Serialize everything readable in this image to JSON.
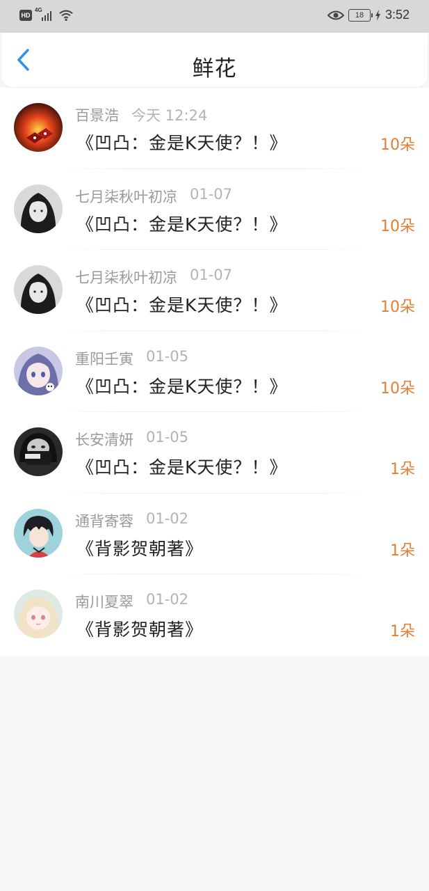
{
  "status_bar": {
    "hd": "HD",
    "network": "4G",
    "battery": "18",
    "time": "3:52"
  },
  "header": {
    "title": "鲜花"
  },
  "items": [
    {
      "name": "百景浩",
      "date": "今天 12:24",
      "book": "《凹凸：金是K天使？！》",
      "count": "10朵",
      "avatar_icon": "dice-fire-avatar"
    },
    {
      "name": "七月柒秋叶初凉",
      "date": "01-07",
      "book": "《凹凸：金是K天使？！》",
      "count": "10朵",
      "avatar_icon": "girl-bw-avatar"
    },
    {
      "name": "七月柒秋叶初凉",
      "date": "01-07",
      "book": "《凹凸：金是K天使？！》",
      "count": "10朵",
      "avatar_icon": "girl-bw-avatar"
    },
    {
      "name": "重阳壬寅",
      "date": "01-05",
      "book": "《凹凸：金是K天使？！》",
      "count": "10朵",
      "avatar_icon": "anime-girl-purple-avatar"
    },
    {
      "name": "长安清妍",
      "date": "01-05",
      "book": "《凹凸：金是K天使？！》",
      "count": "1朵",
      "avatar_icon": "supreme-mask-avatar"
    },
    {
      "name": "通背寄蓉",
      "date": "01-02",
      "book": "《背影贺朝著》",
      "count": "1朵",
      "avatar_icon": "anime-boy-avatar"
    },
    {
      "name": "南川夏翠",
      "date": "01-02",
      "book": "《背影贺朝著》",
      "count": "1朵",
      "avatar_icon": "anime-girl-blonde-avatar"
    }
  ],
  "colors": {
    "accent": "#2f93ea",
    "count": "#e57d33"
  }
}
